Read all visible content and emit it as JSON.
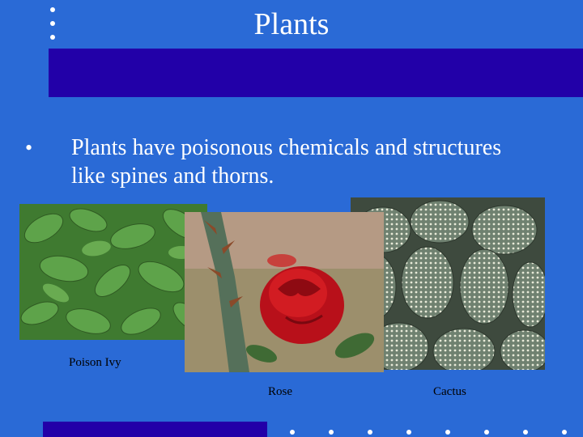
{
  "slide": {
    "title": "Plants",
    "bullet_marker": "•",
    "bullet_text": "Plants have poisonous chemicals and structures like spines and thorns."
  },
  "images": [
    {
      "caption": "Poison Ivy",
      "subject": "poison ivy leaves"
    },
    {
      "caption": "Rose",
      "subject": "red rose with thorny stem"
    },
    {
      "caption": "Cactus",
      "subject": "bunny ear cactus pads"
    }
  ],
  "colors": {
    "background": "#2a6ad6",
    "title_bar": "#2200a8",
    "text": "#ffffff"
  }
}
